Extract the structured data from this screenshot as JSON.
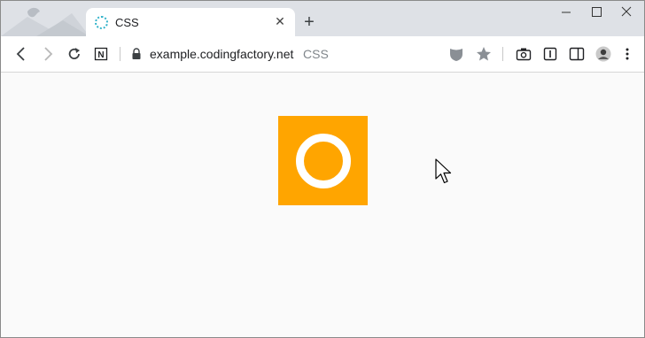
{
  "browser": {
    "tab": {
      "title": "CSS"
    },
    "address_bar": {
      "domain": "example.codingfactory.net",
      "page_title": "CSS"
    }
  },
  "icons": {
    "back": "arrow-left-icon",
    "forward": "arrow-right-icon",
    "reload": "reload-icon",
    "notion": "notion-icon",
    "lock": "lock-icon",
    "shield": "shield-extension-icon",
    "star": "star-icon",
    "screenshot": "camera-icon",
    "reader": "reader-icon",
    "sidebar": "sidebar-icon",
    "menu": "more-vertical-icon"
  },
  "colors": {
    "box": "#ffa500",
    "ring": "#ffffff",
    "page_background": "#fafafa"
  }
}
